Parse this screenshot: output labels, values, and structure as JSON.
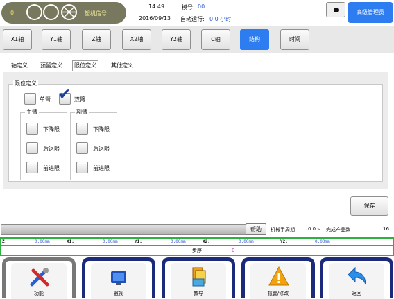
{
  "header": {
    "counter": "0",
    "signal_label": "塑机信号",
    "time": "14:49",
    "date": "2016/09/13",
    "mold_label": "模号:",
    "mold_value": "00",
    "auto_run_label": "自动运行:",
    "auto_run_value": "0.0 小时",
    "user_label": "高级管理员"
  },
  "axis_tabs": [
    {
      "label": "X1轴",
      "active": false
    },
    {
      "label": "Y1轴",
      "active": false
    },
    {
      "label": "Z轴",
      "active": false
    },
    {
      "label": "X2轴",
      "active": false
    },
    {
      "label": "Y2轴",
      "active": false
    },
    {
      "label": "C轴",
      "active": false
    },
    {
      "label": "结构",
      "active": true
    },
    {
      "label": "时间",
      "active": false
    }
  ],
  "sub_tabs": [
    {
      "label": "轴定义",
      "active": false
    },
    {
      "label": "预留定义",
      "active": false
    },
    {
      "label": "限位定义",
      "active": true
    },
    {
      "label": "其他定义",
      "active": false
    }
  ],
  "limit": {
    "group_title": "限位定义",
    "single_arm": {
      "label": "单臂",
      "checked": false
    },
    "double_arm": {
      "label": "双臂",
      "checked": true
    },
    "main_arm": {
      "title": "主臂",
      "options": [
        {
          "label": "下降限",
          "checked": false
        },
        {
          "label": "后退限",
          "checked": false
        },
        {
          "label": "前进限",
          "checked": false
        }
      ]
    },
    "sub_arm": {
      "title": "副臂",
      "options": [
        {
          "label": "下降限",
          "checked": false
        },
        {
          "label": "后退限",
          "checked": false
        },
        {
          "label": "前进限",
          "checked": false
        }
      ]
    }
  },
  "save_label": "保存",
  "help_label": "帮助",
  "cycle": {
    "label": "机械手周期",
    "value": "0.0 s",
    "done_label": "完成产品数",
    "done_value": "16"
  },
  "positions": [
    {
      "label": "Z:",
      "value": "0.00mm"
    },
    {
      "label": "X1:",
      "value": "0.00mm"
    },
    {
      "label": "Y1:",
      "value": "0.00mm"
    },
    {
      "label": "X2:",
      "value": "0.00mm"
    },
    {
      "label": "Y2:",
      "value": "0.00mm"
    }
  ],
  "step": {
    "label": "步序",
    "value": "0"
  },
  "nav": [
    {
      "label": "功能",
      "icon": "tools-icon"
    },
    {
      "label": "监视",
      "icon": "monitor-icon"
    },
    {
      "label": "教导",
      "icon": "teach-icon"
    },
    {
      "label": "报警/修改",
      "icon": "alarm-icon"
    },
    {
      "label": "返回",
      "icon": "return-icon"
    }
  ],
  "colors": {
    "accent": "#2d7cf0",
    "nav_border": "#1c2a7c",
    "status_green": "#2db240",
    "pill": "#77785e"
  }
}
